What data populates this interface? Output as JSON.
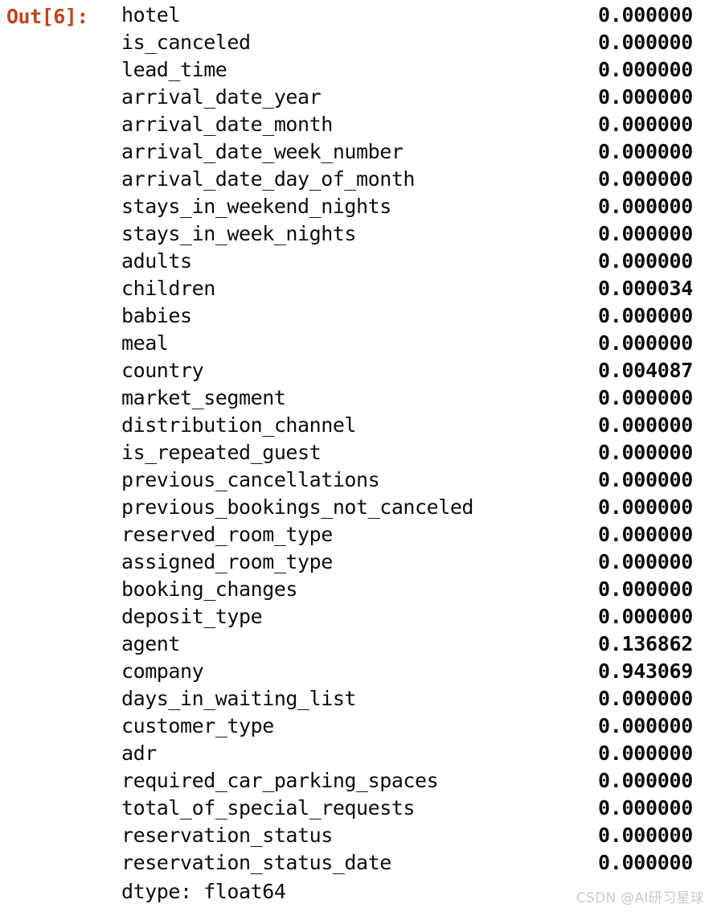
{
  "cell": {
    "prompt": "Out[6]:",
    "prompt_color": "#C3431C",
    "dtype_line": "dtype: float64"
  },
  "series": {
    "rows": [
      {
        "label": "hotel",
        "value": "0.000000"
      },
      {
        "label": "is_canceled",
        "value": "0.000000"
      },
      {
        "label": "lead_time",
        "value": "0.000000"
      },
      {
        "label": "arrival_date_year",
        "value": "0.000000"
      },
      {
        "label": "arrival_date_month",
        "value": "0.000000"
      },
      {
        "label": "arrival_date_week_number",
        "value": "0.000000"
      },
      {
        "label": "arrival_date_day_of_month",
        "value": "0.000000"
      },
      {
        "label": "stays_in_weekend_nights",
        "value": "0.000000"
      },
      {
        "label": "stays_in_week_nights",
        "value": "0.000000"
      },
      {
        "label": "adults",
        "value": "0.000000"
      },
      {
        "label": "children",
        "value": "0.000034"
      },
      {
        "label": "babies",
        "value": "0.000000"
      },
      {
        "label": "meal",
        "value": "0.000000"
      },
      {
        "label": "country",
        "value": "0.004087"
      },
      {
        "label": "market_segment",
        "value": "0.000000"
      },
      {
        "label": "distribution_channel",
        "value": "0.000000"
      },
      {
        "label": "is_repeated_guest",
        "value": "0.000000"
      },
      {
        "label": "previous_cancellations",
        "value": "0.000000"
      },
      {
        "label": "previous_bookings_not_canceled",
        "value": "0.000000"
      },
      {
        "label": "reserved_room_type",
        "value": "0.000000"
      },
      {
        "label": "assigned_room_type",
        "value": "0.000000"
      },
      {
        "label": "booking_changes",
        "value": "0.000000"
      },
      {
        "label": "deposit_type",
        "value": "0.000000"
      },
      {
        "label": "agent",
        "value": "0.136862"
      },
      {
        "label": "company",
        "value": "0.943069"
      },
      {
        "label": "days_in_waiting_list",
        "value": "0.000000"
      },
      {
        "label": "customer_type",
        "value": "0.000000"
      },
      {
        "label": "adr",
        "value": "0.000000"
      },
      {
        "label": "required_car_parking_spaces",
        "value": "0.000000"
      },
      {
        "label": "total_of_special_requests",
        "value": "0.000000"
      },
      {
        "label": "reservation_status",
        "value": "0.000000"
      },
      {
        "label": "reservation_status_date",
        "value": "0.000000"
      }
    ]
  },
  "watermark": {
    "text": "CSDN @AI研习星球",
    "color": "#c9c9c9"
  }
}
